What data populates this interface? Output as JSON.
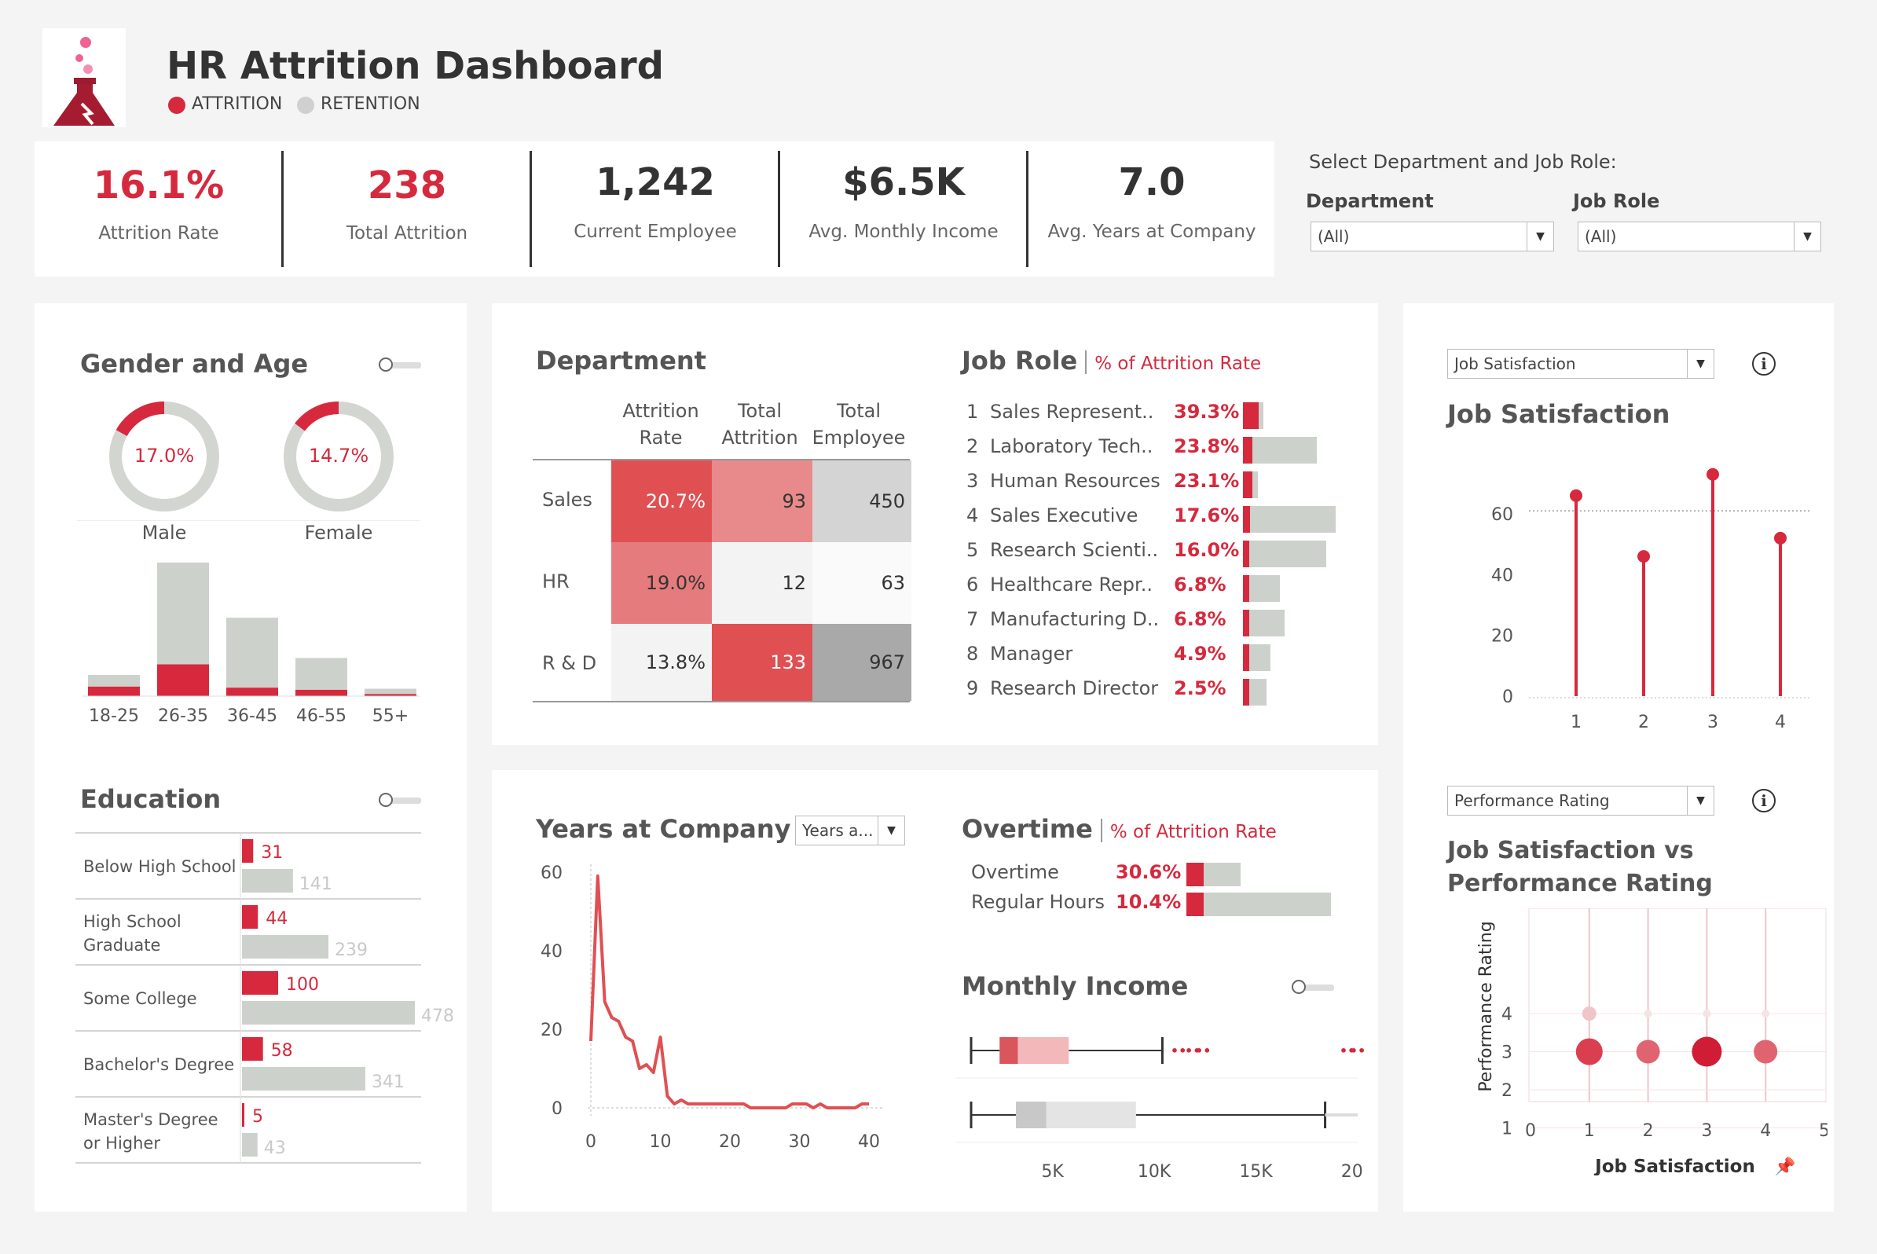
{
  "header": {
    "title": "HR Attrition Dashboard",
    "legend": [
      {
        "label": "ATTRITION",
        "color": "#d6293d"
      },
      {
        "label": "RETENTION",
        "color": "#d0d0d0"
      }
    ],
    "logo_icon": "flask-icon"
  },
  "kpis": [
    {
      "value": "16.1%",
      "label": "Attrition Rate",
      "color": "#d6293d"
    },
    {
      "value": "238",
      "label": "Total Attrition",
      "color": "#d6293d"
    },
    {
      "value": "1,242",
      "label": "Current Employee",
      "color": "#333333"
    },
    {
      "value": "$6.5K",
      "label": "Avg. Monthly Income",
      "color": "#333333"
    },
    {
      "value": "7.0",
      "label": "Avg. Years at Company",
      "color": "#333333"
    }
  ],
  "filters": {
    "title": "Select Department and Job Role:",
    "department": {
      "label": "Department",
      "value": "(All)"
    },
    "job_role": {
      "label": "Job Role",
      "value": "(All)"
    }
  },
  "gender_age": {
    "title": "Gender and Age",
    "donuts": [
      {
        "label": "Male",
        "value": "17.0%",
        "pct": 0.17
      },
      {
        "label": "Female",
        "value": "14.7%",
        "pct": 0.147
      }
    ]
  },
  "education": {
    "title": "Education"
  },
  "department": {
    "title": "Department",
    "headers": [
      [
        "Attrition",
        "Rate"
      ],
      [
        "Total",
        "Attrition"
      ],
      [
        "Total",
        "Employee"
      ]
    ],
    "rows": [
      {
        "name": "Sales",
        "rate": "20.7%",
        "attrition": "93",
        "employee": "450"
      },
      {
        "name": "HR",
        "rate": "19.0%",
        "attrition": "12",
        "employee": "63"
      },
      {
        "name": "R & D",
        "rate": "13.8%",
        "attrition": "133",
        "employee": "967"
      }
    ]
  },
  "job_role": {
    "title": "Job Role",
    "subtitle": "% of Attrition Rate",
    "rows": [
      {
        "rank": "1",
        "name": "Sales Represent..",
        "rate": "39.3%",
        "pct": 39.3,
        "total": 20
      },
      {
        "rank": "2",
        "name": "Laboratory Tech..",
        "rate": "23.8%",
        "pct": 23.8,
        "total": 80
      },
      {
        "rank": "3",
        "name": "Human Resources",
        "rate": "23.1%",
        "pct": 23.1,
        "total": 16
      },
      {
        "rank": "4",
        "name": "Sales Executive",
        "rate": "17.6%",
        "pct": 17.6,
        "total": 100
      },
      {
        "rank": "5",
        "name": "Research Scienti..",
        "rate": "16.0%",
        "pct": 16.0,
        "total": 90
      },
      {
        "rank": "6",
        "name": "Healthcare Repr..",
        "rate": "6.8%",
        "pct": 6.8,
        "total": 40
      },
      {
        "rank": "7",
        "name": "Manufacturing D..",
        "rate": "6.8%",
        "pct": 6.8,
        "total": 45
      },
      {
        "rank": "8",
        "name": "Manager",
        "rate": "4.9%",
        "pct": 4.9,
        "total": 30
      },
      {
        "rank": "9",
        "name": "Research Director",
        "rate": "2.5%",
        "pct": 2.5,
        "total": 25
      }
    ]
  },
  "years": {
    "title": "Years at Company",
    "dropdown": "Years a..."
  },
  "overtime": {
    "title": "Overtime",
    "subtitle": "% of Attrition Rate",
    "rows": [
      {
        "name": "Overtime",
        "rate": "30.6%",
        "pct": 30.6,
        "total": 60
      },
      {
        "name": "Regular Hours",
        "rate": "10.4%",
        "pct": 10.4,
        "total": 160
      }
    ]
  },
  "monthly_income": {
    "title": "Monthly Income"
  },
  "job_sat": {
    "dropdown": "Job Satisfaction",
    "title": "Job Satisfaction"
  },
  "perf": {
    "dropdown": "Performance Rating",
    "title_line1": "Job Satisfaction vs",
    "title_line2": "Performance Rating"
  },
  "chart_data": [
    {
      "id": "age",
      "type": "bar",
      "categories": [
        "18-25",
        "26-35",
        "36-45",
        "46-55",
        "55+"
      ],
      "series": [
        {
          "name": "ATTRITION",
          "values": [
            9,
            30,
            8,
            6,
            2
          ]
        },
        {
          "name": "RETENTION",
          "values": [
            11,
            96,
            66,
            30,
            5
          ]
        }
      ]
    },
    {
      "id": "education",
      "type": "bar",
      "orientation": "horizontal",
      "categories": [
        "Below High School",
        "High School Graduate",
        "Some College",
        "Bachelor's Degree",
        "Master's Degree or Higher"
      ],
      "series": [
        {
          "name": "ATTRITION",
          "values": [
            31,
            44,
            100,
            58,
            5
          ]
        },
        {
          "name": "RETENTION",
          "values": [
            141,
            239,
            478,
            341,
            43
          ]
        }
      ]
    },
    {
      "id": "years_at_company",
      "type": "line",
      "x": [
        0,
        1,
        2,
        3,
        4,
        5,
        6,
        7,
        8,
        9,
        10,
        11,
        12,
        13,
        14,
        15,
        16,
        17,
        18,
        19,
        20,
        21,
        22,
        23,
        24,
        25,
        26,
        27,
        28,
        29,
        30,
        31,
        32,
        33,
        34,
        35,
        36,
        37,
        38,
        39,
        40
      ],
      "y": [
        17,
        59,
        27,
        23,
        22,
        18,
        17,
        10,
        11,
        9,
        18,
        3,
        1,
        2,
        1,
        1,
        1,
        1,
        1,
        1,
        1,
        1,
        1,
        0,
        0,
        0,
        0,
        0,
        0,
        1,
        1,
        1,
        0,
        1,
        0,
        0,
        0,
        0,
        0,
        1,
        1
      ],
      "xticks": [
        0,
        10,
        20,
        30,
        40
      ],
      "yticks": [
        0,
        20,
        40,
        60
      ],
      "ylim": [
        0,
        62
      ]
    },
    {
      "id": "monthly_income",
      "type": "box",
      "xticks": [
        "5K",
        "10K",
        "15K",
        "20K"
      ],
      "boxes": [
        {
          "name": "ATTRITION",
          "min": 1000,
          "q1": 2400,
          "median": 3300,
          "q3": 5800,
          "max": 10400,
          "outliers": [
            11200,
            11900,
            12400,
            19500,
            20000
          ]
        },
        {
          "name": "RETENTION",
          "min": 1000,
          "q1": 3200,
          "median": 4700,
          "q3": 9100,
          "max": 18400,
          "max_tick": 20000
        }
      ]
    },
    {
      "id": "job_satisfaction",
      "type": "lollipop",
      "categories": [
        "1",
        "2",
        "3",
        "4"
      ],
      "values": [
        66,
        46,
        73,
        52
      ],
      "reference": 61,
      "yticks": [
        0,
        20,
        40,
        60
      ],
      "ylim": [
        0,
        75
      ]
    },
    {
      "id": "sat_vs_perf",
      "type": "scatter",
      "xlabel": "Job Satisfaction",
      "ylabel": "Performance Rating",
      "xticks": [
        "0",
        "1",
        "2",
        "3",
        "4",
        "5"
      ],
      "yticks": [
        "1",
        "2",
        "3",
        "4"
      ],
      "points": [
        {
          "x": 1,
          "y": 3,
          "size": 3
        },
        {
          "x": 2,
          "y": 3,
          "size": 2
        },
        {
          "x": 3,
          "y": 3,
          "size": 4
        },
        {
          "x": 4,
          "y": 3,
          "size": 2
        },
        {
          "x": 1,
          "y": 4,
          "size": 1
        },
        {
          "x": 2,
          "y": 4,
          "size": 0.4
        },
        {
          "x": 3,
          "y": 4,
          "size": 0.3
        },
        {
          "x": 4,
          "y": 4,
          "size": 0.4
        }
      ]
    }
  ]
}
